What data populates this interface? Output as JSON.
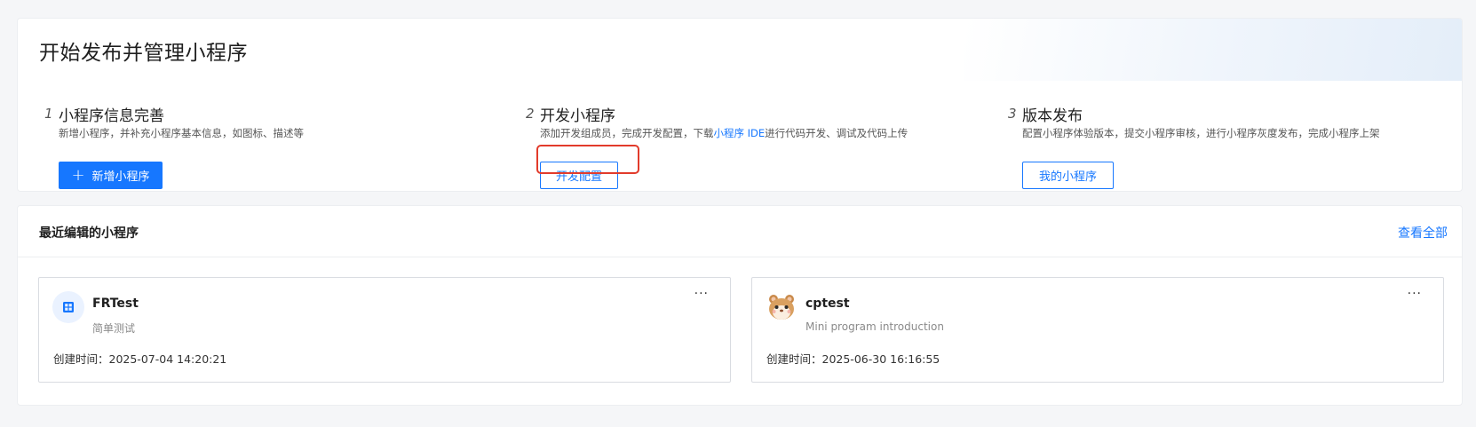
{
  "page": {
    "title": "开始发布并管理小程序"
  },
  "steps": [
    {
      "number": "1",
      "title": "小程序信息完善",
      "description": "新增小程序，并补充小程序基本信息，如图标、描述等",
      "button_label": "新增小程序",
      "button_icon": "plus-icon"
    },
    {
      "number": "2",
      "title": "开发小程序",
      "description_before": "添加开发组成员，完成开发配置，下载",
      "description_link": "小程序 IDE",
      "description_after": "进行代码开发、调试及代码上传",
      "button_label": "开发配置"
    },
    {
      "number": "3",
      "title": "版本发布",
      "description": "配置小程序体验版本，提交小程序审核，进行小程序灰度发布，完成小程序上架",
      "button_label": "我的小程序"
    }
  ],
  "recent": {
    "title": "最近编辑的小程序",
    "view_all_label": "查看全部",
    "cards": [
      {
        "name": "FRTest",
        "description": "简单测试",
        "created_time": "创建时间：2025-07-04 14:20:21",
        "more_label": "···",
        "icon": "app-grid-icon"
      },
      {
        "name": "cptest",
        "description": "Mini program introduction",
        "created_time": "创建时间：2025-06-30 16:16:55",
        "more_label": "···",
        "icon": "hamster-avatar-icon"
      }
    ]
  },
  "colors": {
    "accent": "#1677ff",
    "highlight": "#e23b2b",
    "background": "#f5f6f8"
  }
}
